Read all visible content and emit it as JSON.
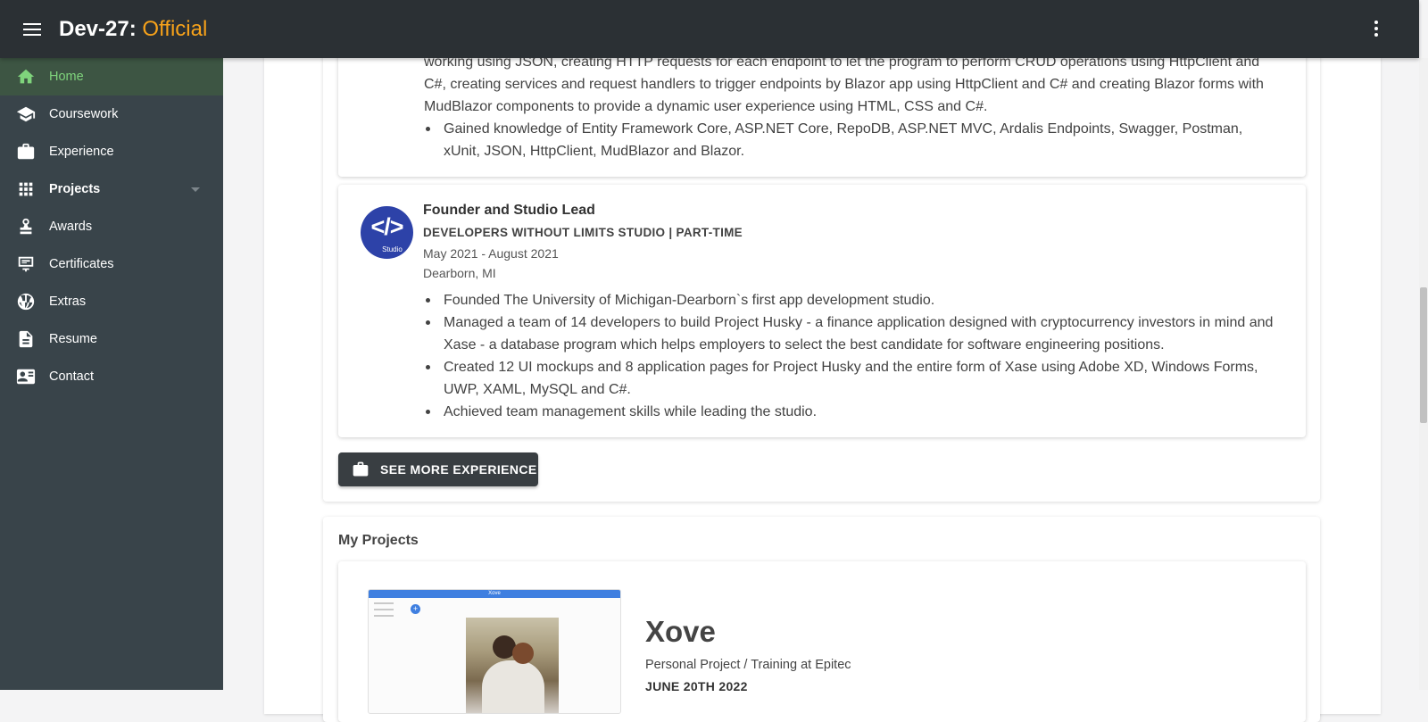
{
  "app": {
    "brand_main": "Dev-27:",
    "brand_accent": "Official"
  },
  "sidebar": {
    "items": [
      {
        "label": "Home",
        "icon": "home-icon"
      },
      {
        "label": "Coursework",
        "icon": "graduation-cap-icon"
      },
      {
        "label": "Experience",
        "icon": "briefcase-icon"
      },
      {
        "label": "Projects",
        "icon": "apps-grid-icon"
      },
      {
        "label": "Awards",
        "icon": "award-icon"
      },
      {
        "label": "Certificates",
        "icon": "certificate-icon"
      },
      {
        "label": "Extras",
        "icon": "basketball-icon"
      },
      {
        "label": "Resume",
        "icon": "document-icon"
      },
      {
        "label": "Contact",
        "icon": "contact-card-icon"
      }
    ]
  },
  "experience": {
    "prev_bullets": [
      "working using JSON, creating HTTP requests for each endpoint to let the program to perform CRUD operations using HttpClient and C#, creating services and request handlers to trigger endpoints by Blazor app using HttpClient and C# and creating Blazor forms with MudBlazor components to provide a dynamic user experience using HTML, CSS and C#.",
      "Gained knowledge of Entity Framework Core, ASP.NET Core, RepoDB, ASP.NET MVC, Ardalis Endpoints, Swagger, Postman, xUnit, JSON, HttpClient, MudBlazor and Blazor."
    ],
    "job": {
      "logo_text": "</>",
      "logo_sub": "Studio",
      "title": "Founder and Studio Lead",
      "company": "DEVELOPERS WITHOUT LIMITS STUDIO | PART-TIME",
      "dates": "May 2021 - August 2021",
      "location": "Dearborn, MI",
      "bullets": [
        "Founded The University of Michigan-Dearborn`s first app development studio.",
        "Managed a team of 14 developers to build Project Husky - a finance application designed with cryptocurrency investors in mind and Xase - a database program which helps employers to select the best candidate for software engineering positions.",
        "Created 12 UI mockups and 8 application pages for Project Husky and the entire form of Xase using Adobe XD, Windows Forms, UWP, XAML, MySQL and C#.",
        "Achieved team management skills while leading the studio."
      ]
    },
    "see_more_label": "SEE MORE EXPERIENCE"
  },
  "projects": {
    "heading": "My Projects",
    "item": {
      "screenshot_title": "Xove",
      "name": "Xove",
      "subtitle": "Personal Project / Training at Epitec",
      "date": "JUNE 20TH 2022"
    }
  },
  "colors": {
    "appbar": "#2b3034",
    "sidebar": "#39444a",
    "accent_orange": "#f7a21a",
    "active_green": "#7fd47c",
    "button_dark": "#393e42"
  }
}
